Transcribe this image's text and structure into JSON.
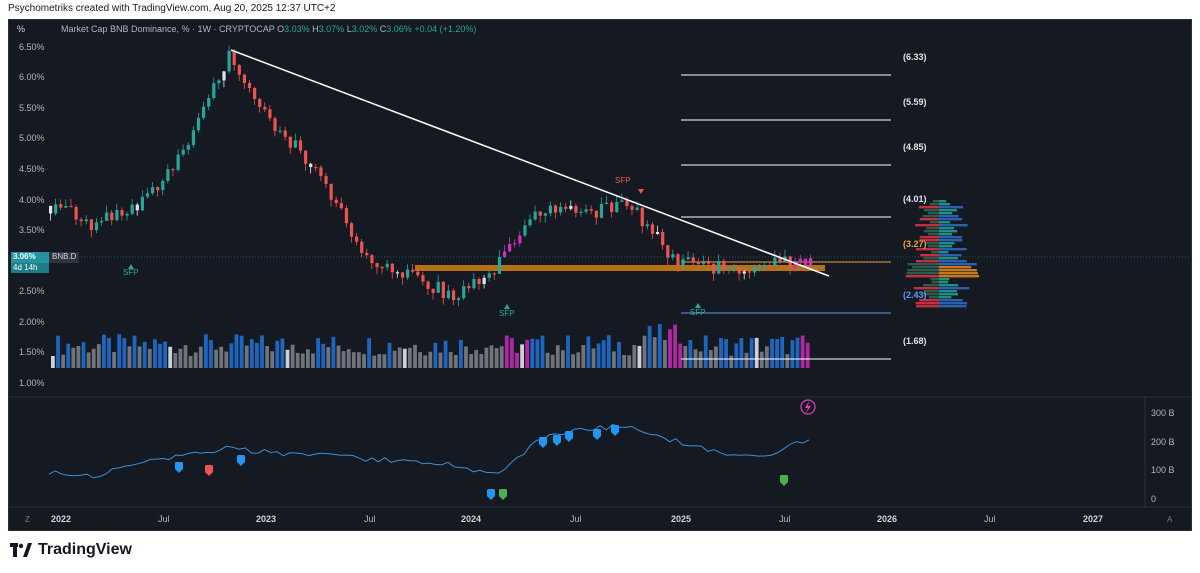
{
  "credit": "Psychometriks created with TradingView.com, Aug 20, 2025 12:37 UTC+2",
  "legend": {
    "title": "Market Cap BNB Dominance, % · 1W · CRYPTOCAP",
    "o_label": "O",
    "o": "3.03%",
    "h_label": "H",
    "h": "3.07%",
    "l_label": "L",
    "l": "3.02%",
    "c_label": "C",
    "c": "3.06%",
    "change": "+0.04 (+1.20%)"
  },
  "axis_unit": "%",
  "price_tag": {
    "value": "3.06%",
    "countdown": "4d 14h",
    "symbol": "BNB.D"
  },
  "y_ticks": [
    "6.50%",
    "6.00%",
    "5.50%",
    "5.00%",
    "4.50%",
    "4.00%",
    "3.50%",
    "2.50%",
    "2.00%",
    "1.50%",
    "1.00%"
  ],
  "y_ticks_lower": [
    "300 B",
    "200 B",
    "100 B",
    "0"
  ],
  "x_ticks": [
    {
      "label": "2022",
      "bold": true
    },
    {
      "label": "Jul",
      "bold": false
    },
    {
      "label": "2023",
      "bold": true
    },
    {
      "label": "Jul",
      "bold": false
    },
    {
      "label": "2024",
      "bold": true
    },
    {
      "label": "Jul",
      "bold": false
    },
    {
      "label": "2025",
      "bold": true
    },
    {
      "label": "Jul",
      "bold": false
    },
    {
      "label": "2026",
      "bold": true
    },
    {
      "label": "Jul",
      "bold": false
    },
    {
      "label": "2027",
      "bold": true
    }
  ],
  "levels": [
    {
      "label": "(6.33)",
      "color": "white"
    },
    {
      "label": "(5.59)",
      "color": "white"
    },
    {
      "label": "(4.85)",
      "color": "white"
    },
    {
      "label": "(4.01)",
      "color": "white"
    },
    {
      "label": "(3.27)",
      "color": "orange"
    },
    {
      "label": "(2.43)",
      "color": "blue"
    },
    {
      "label": "(1.68)",
      "color": "white"
    }
  ],
  "annotations": [
    {
      "text": "SFP",
      "color": "green"
    },
    {
      "text": "SFP",
      "color": "green"
    },
    {
      "text": "SFP",
      "color": "red"
    },
    {
      "text": "SFP",
      "color": "green"
    }
  ],
  "bottom_buttons": {
    "left": "Z",
    "right": "A"
  },
  "brand": "TradingView",
  "colors": {
    "up": "#26a69a",
    "down": "#ef5350",
    "accent": "#2196f3",
    "bg": "#151922",
    "orange_band": "#c77a1a",
    "magenta": "#d030c0"
  },
  "icons": [
    "lightning-icon",
    "tradingview-logo-icon"
  ],
  "chart_data": {
    "type": "line",
    "title": "Market Cap BNB Dominance, % · 1W · CRYPTOCAP",
    "xlabel": "",
    "ylabel": "%",
    "ylim": [
      1.0,
      6.6
    ],
    "x": [
      "2022-01",
      "2022-04",
      "2022-07",
      "2022-10",
      "2022-12",
      "2023-01",
      "2023-04",
      "2023-07",
      "2023-10",
      "2023-12",
      "2024-01",
      "2024-04",
      "2024-07",
      "2024-10",
      "2025-01",
      "2025-04",
      "2025-07",
      "2025-08"
    ],
    "series": [
      {
        "name": "BNB.D",
        "values": [
          3.9,
          3.6,
          3.9,
          4.8,
          6.4,
          5.2,
          4.5,
          3.1,
          2.8,
          2.4,
          2.9,
          3.9,
          3.8,
          3.9,
          3.0,
          2.9,
          2.9,
          3.06
        ]
      }
    ],
    "lower_series_ylim": [
      0,
      320
    ],
    "lower_series": [
      95,
      80,
      120,
      150,
      175,
      160,
      150,
      140,
      130,
      120,
      80,
      210,
      240,
      255,
      200,
      160,
      150,
      210
    ]
  }
}
